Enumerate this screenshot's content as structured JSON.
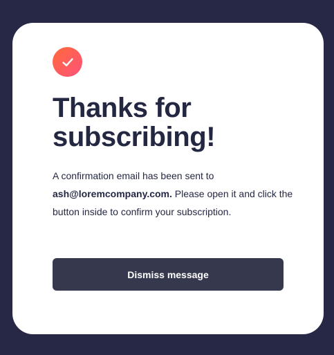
{
  "colors": {
    "background": "#262846",
    "card": "#ffffff",
    "text": "#242742",
    "button": "#36384e",
    "button_text": "#ffffff",
    "icon_gradient_start": "#ff6a3a",
    "icon_gradient_end": "#ff527b"
  },
  "icon": {
    "name": "check-icon"
  },
  "content": {
    "title": "Thanks for subscribing!",
    "message_before_email": "A confirmation email has been sent to",
    "email": "ash@loremcompany.com.",
    "message_after_email": "Please open it and click the button inside to confirm your subscription."
  },
  "button": {
    "label": "Dismiss message"
  }
}
